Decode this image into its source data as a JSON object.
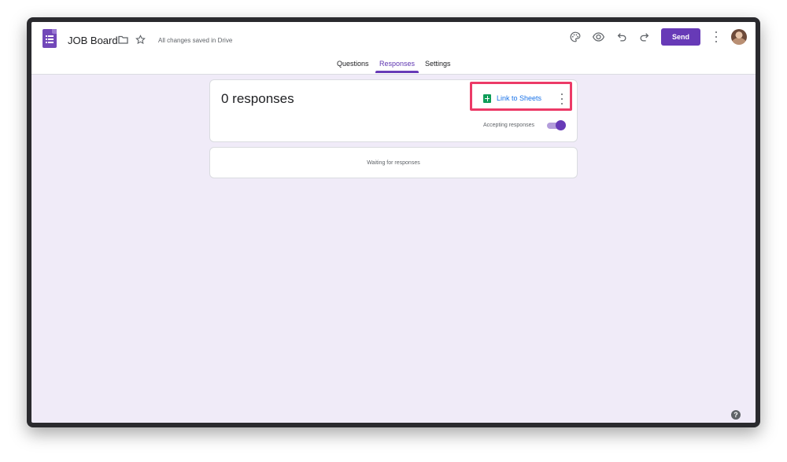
{
  "header": {
    "doc_title": "JOB Board",
    "saved_status": "All changes saved in Drive",
    "send_label": "Send",
    "icons": [
      "forms-logo-icon",
      "folder-icon",
      "star-icon",
      "palette-icon",
      "eye-icon",
      "undo-icon",
      "redo-icon",
      "more-vert-icon",
      "avatar"
    ]
  },
  "tabs": [
    {
      "label": "Questions"
    },
    {
      "label": "Responses",
      "active": true
    },
    {
      "label": "Settings"
    }
  ],
  "responses": {
    "count_text": "0 responses",
    "link_label": "Link to Sheets",
    "accepting_label": "Accepting responses",
    "accepting": true,
    "waiting_text": "Waiting for responses"
  },
  "help_icon_glyph": "?",
  "colors": {
    "accent": "#673ab7",
    "background": "#f0ebf8",
    "highlight": "#ec3a67",
    "sheets_green": "#0f9d58",
    "link_blue": "#1a73e8"
  }
}
